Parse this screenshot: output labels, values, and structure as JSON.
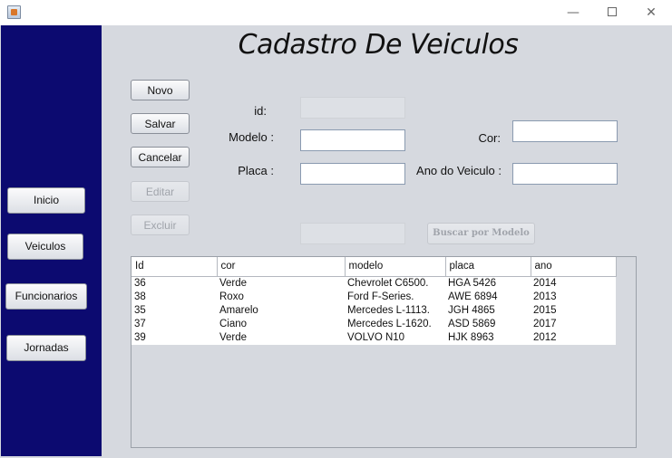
{
  "window": {
    "title": "",
    "minimize": "—",
    "close": "✕"
  },
  "colors": {
    "sidebar": "#0c0a70",
    "panel": "#d6d9df",
    "table_bg": "#ffffff"
  },
  "page_title": "Cadastro De Veiculos",
  "sidebar": {
    "items": [
      {
        "label": "Inicio"
      },
      {
        "label": "Veiculos"
      },
      {
        "label": "Funcionarios"
      },
      {
        "label": "Jornadas"
      }
    ]
  },
  "actions": {
    "novo": "Novo",
    "salvar": "Salvar",
    "cancelar": "Cancelar",
    "editar": "Editar",
    "excluir": "Excluir"
  },
  "form": {
    "id_label": "id:",
    "id_value": "",
    "modelo_label": "Modelo :",
    "modelo_value": "",
    "cor_label": "Cor:",
    "cor_value": "",
    "placa_label": "Placa :",
    "placa_value": "",
    "ano_label": "Ano do Veiculo :",
    "ano_value": ""
  },
  "search": {
    "value": "",
    "button_label": "Buscar por Modelo"
  },
  "table": {
    "columns": [
      "Id",
      "cor",
      "modelo",
      "placa",
      "ano"
    ],
    "rows": [
      [
        "36",
        "Verde",
        "Chevrolet C6500.",
        "HGA 5426",
        "2014"
      ],
      [
        "38",
        "Roxo",
        "Ford F-Series.",
        "AWE 6894",
        "2013"
      ],
      [
        "35",
        "Amarelo",
        "Mercedes L-1113.",
        "JGH 4865",
        "2015"
      ],
      [
        "37",
        "Ciano",
        "Mercedes L-1620.",
        "ASD 5869",
        "2017"
      ],
      [
        "39",
        "Verde",
        "VOLVO N10",
        "HJK 8963",
        "2012"
      ]
    ]
  }
}
